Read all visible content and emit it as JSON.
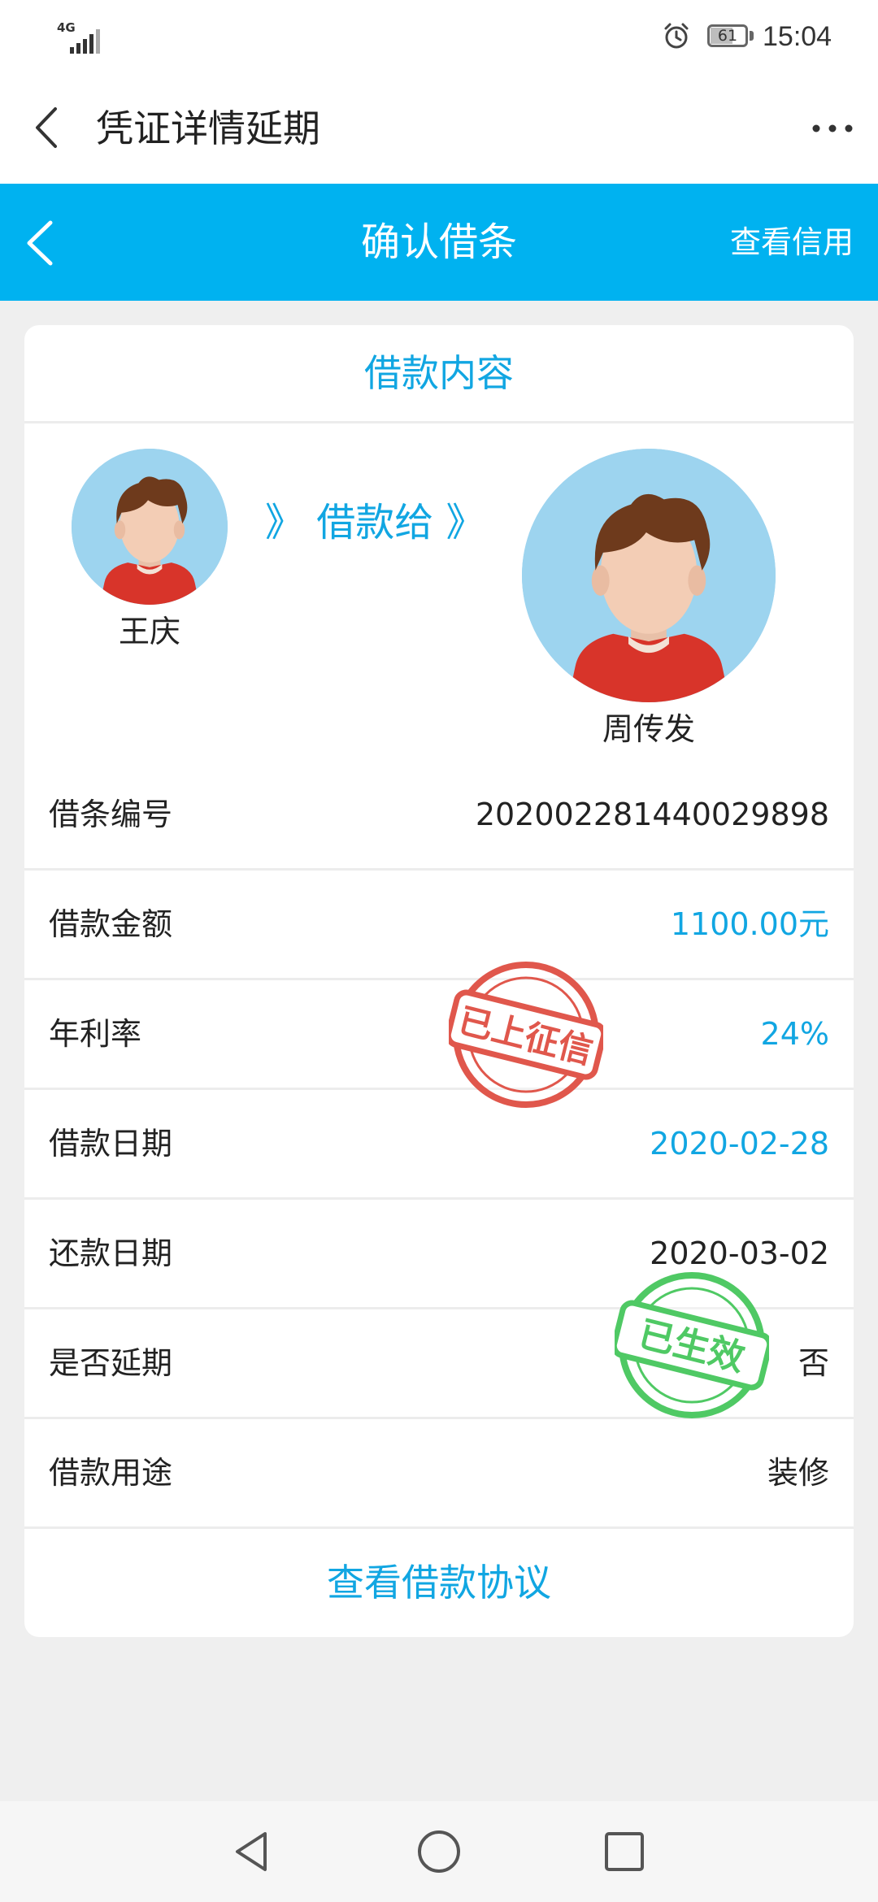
{
  "status_bar": {
    "network": "4G",
    "battery_level": "61",
    "time": "15:04"
  },
  "app_nav": {
    "title": "凭证详情延期"
  },
  "page_header": {
    "title": "确认借条",
    "right_action": "查看信用",
    "background_color": "#00b2f0"
  },
  "loan_card": {
    "section_title": "借款内容",
    "lender_name": "王庆",
    "transfer_label": "》 借款给 》",
    "borrower_name": "周传发",
    "rows": [
      {
        "label": "借条编号",
        "value": "202002281440029898"
      },
      {
        "label": "借款金额",
        "value": "1100.00元"
      },
      {
        "label": "年利率",
        "value": "24%"
      },
      {
        "label": "借款日期",
        "value": "2020-02-28"
      },
      {
        "label": "还款日期",
        "value": "2020-03-02"
      },
      {
        "label": "是否延期",
        "value": "否"
      },
      {
        "label": "借款用途",
        "value": "装修"
      }
    ],
    "agreement_link": "查看借款协议"
  },
  "stamps": {
    "credit_reported": "已上征信",
    "credit_reported_color": "#e0574c",
    "effective": "已生效",
    "effective_color": "#4fc964"
  },
  "accent_color": "#11a6e2"
}
